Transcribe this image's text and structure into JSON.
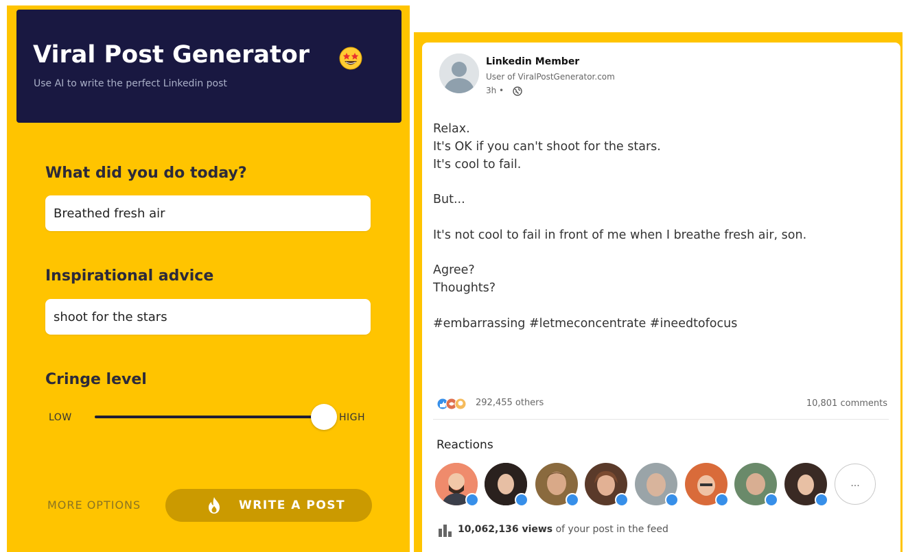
{
  "generator": {
    "title": "Viral Post Generator",
    "title_emoji": "star-struck-emoji",
    "subtitle": "Use AI to write the perfect Linkedin post",
    "question_1": "What did you do today?",
    "answer_1": "Breathed fresh air",
    "question_2": "Inspirational advice",
    "answer_2": "shoot for the stars",
    "question_3": "Cringe level",
    "slider": {
      "low_label": "LOW",
      "high_label": "HIGH",
      "value_fraction": 0.95
    },
    "more_options": "MORE OPTIONS",
    "write_button": "WRITE A POST",
    "write_icon": "flame-icon"
  },
  "post": {
    "author": "Linkedin Member",
    "author_sub": "User of ViralPostGenerator.com",
    "time": "3h •",
    "body": "Relax.\nIt's OK if you can't shoot for the stars.\nIt's cool to fail.\n\nBut...\n\nIt's not cool to fail in front of me when I breathe fresh air, son.\n\nAgree?\nThoughts?\n\n#embarrassing #letmeconcentrate #ineedtofocus",
    "reactions_summary": "292,455 others",
    "comments": "10,801 comments",
    "reactions_title": "Reactions",
    "more_reactors": "...",
    "views_count": "10,062,136 views",
    "views_suffix": " of your post in the feed"
  },
  "colors": {
    "panel_yellow": "#ffc400",
    "hero_navy": "#191841",
    "button_gold": "#cb9a00",
    "like_blue": "#378fe9"
  }
}
